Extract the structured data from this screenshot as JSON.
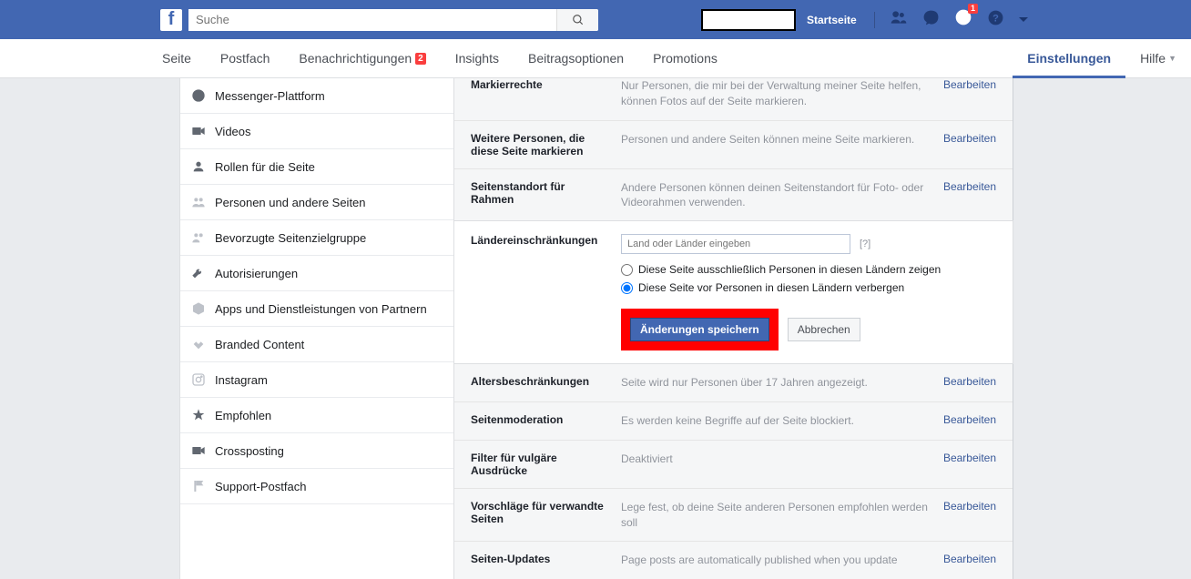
{
  "header": {
    "search_placeholder": "Suche",
    "home_label": "Startseite",
    "notification_count": "1"
  },
  "nav": {
    "tabs": [
      {
        "label": "Seite"
      },
      {
        "label": "Postfach"
      },
      {
        "label": "Benachrichtigungen",
        "badge": "2"
      },
      {
        "label": "Insights"
      },
      {
        "label": "Beitragsoptionen"
      },
      {
        "label": "Promotions"
      }
    ],
    "active_tab": "Einstellungen",
    "help_label": "Hilfe"
  },
  "sidebar": {
    "items": [
      {
        "label": "Messenger-Plattform",
        "icon": "message"
      },
      {
        "label": "Videos",
        "icon": "video"
      },
      {
        "label": "Rollen für die Seite",
        "icon": "person"
      },
      {
        "label": "Personen und andere Seiten",
        "icon": "people"
      },
      {
        "label": "Bevorzugte Seitenzielgruppe",
        "icon": "people"
      },
      {
        "label": "Autorisierungen",
        "icon": "wrench"
      },
      {
        "label": "Apps und Dienstleistungen von Partnern",
        "icon": "box"
      },
      {
        "label": "Branded Content",
        "icon": "handshake"
      },
      {
        "label": "Instagram",
        "icon": "instagram"
      },
      {
        "label": "Empfohlen",
        "icon": "star"
      },
      {
        "label": "Crossposting",
        "icon": "video"
      },
      {
        "label": "Support-Postfach",
        "icon": "flag"
      }
    ]
  },
  "settings": {
    "rows": [
      {
        "label": "Markierrechte",
        "value": "Nur Personen, die mir bei der Verwaltung meiner Seite helfen, können Fotos auf der Seite markieren.",
        "edit": "Bearbeiten"
      },
      {
        "label": "Weitere Personen, die diese Seite markieren",
        "value": "Personen und andere Seiten können meine Seite markieren.",
        "edit": "Bearbeiten"
      },
      {
        "label": "Seitenstandort für Rahmen",
        "value": "Andere Personen können deinen Seitenstandort für Foto- oder Videorahmen verwenden.",
        "edit": "Bearbeiten"
      }
    ],
    "country": {
      "label": "Ländereinschränkungen",
      "input_placeholder": "Land oder Länder eingeben",
      "help": "[?]",
      "radio1": "Diese Seite ausschließlich Personen in diesen Ländern zeigen",
      "radio2": "Diese Seite vor Personen in diesen Ländern verbergen",
      "save": "Änderungen speichern",
      "cancel": "Abbrechen"
    },
    "rows_after": [
      {
        "label": "Altersbeschränkungen",
        "value": "Seite wird nur Personen über 17 Jahren angezeigt.",
        "edit": "Bearbeiten"
      },
      {
        "label": "Seitenmoderation",
        "value": "Es werden keine Begriffe auf der Seite blockiert.",
        "edit": "Bearbeiten"
      },
      {
        "label": "Filter für vulgäre Ausdrücke",
        "value": "Deaktiviert",
        "edit": "Bearbeiten"
      },
      {
        "label": "Vorschläge für verwandte Seiten",
        "value": "Lege fest, ob deine Seite anderen Personen empfohlen werden soll",
        "edit": "Bearbeiten"
      },
      {
        "label": "Seiten-Updates",
        "value": "Page posts are automatically published when you update",
        "edit": "Bearbeiten"
      }
    ]
  }
}
